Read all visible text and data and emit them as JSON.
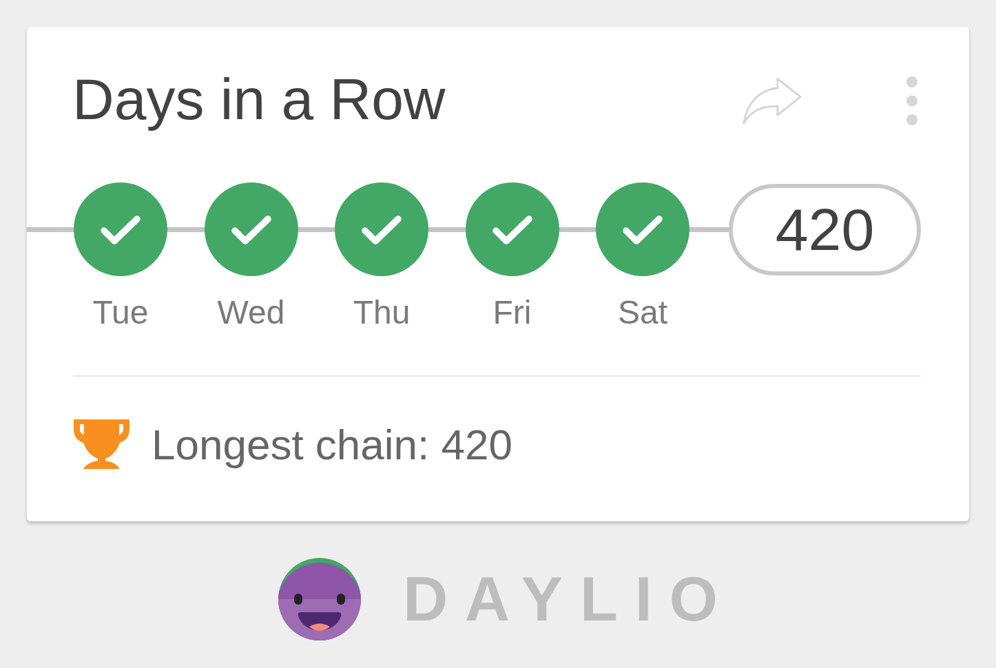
{
  "card": {
    "title": "Days in a Row",
    "streak": {
      "days": [
        {
          "label": "Tue",
          "checked": true
        },
        {
          "label": "Wed",
          "checked": true
        },
        {
          "label": "Thu",
          "checked": true
        },
        {
          "label": "Fri",
          "checked": true
        },
        {
          "label": "Sat",
          "checked": true
        }
      ],
      "count": "420"
    },
    "longest_chain": "Longest chain: 420"
  },
  "brand": {
    "wordmark": "DAYLIO"
  }
}
